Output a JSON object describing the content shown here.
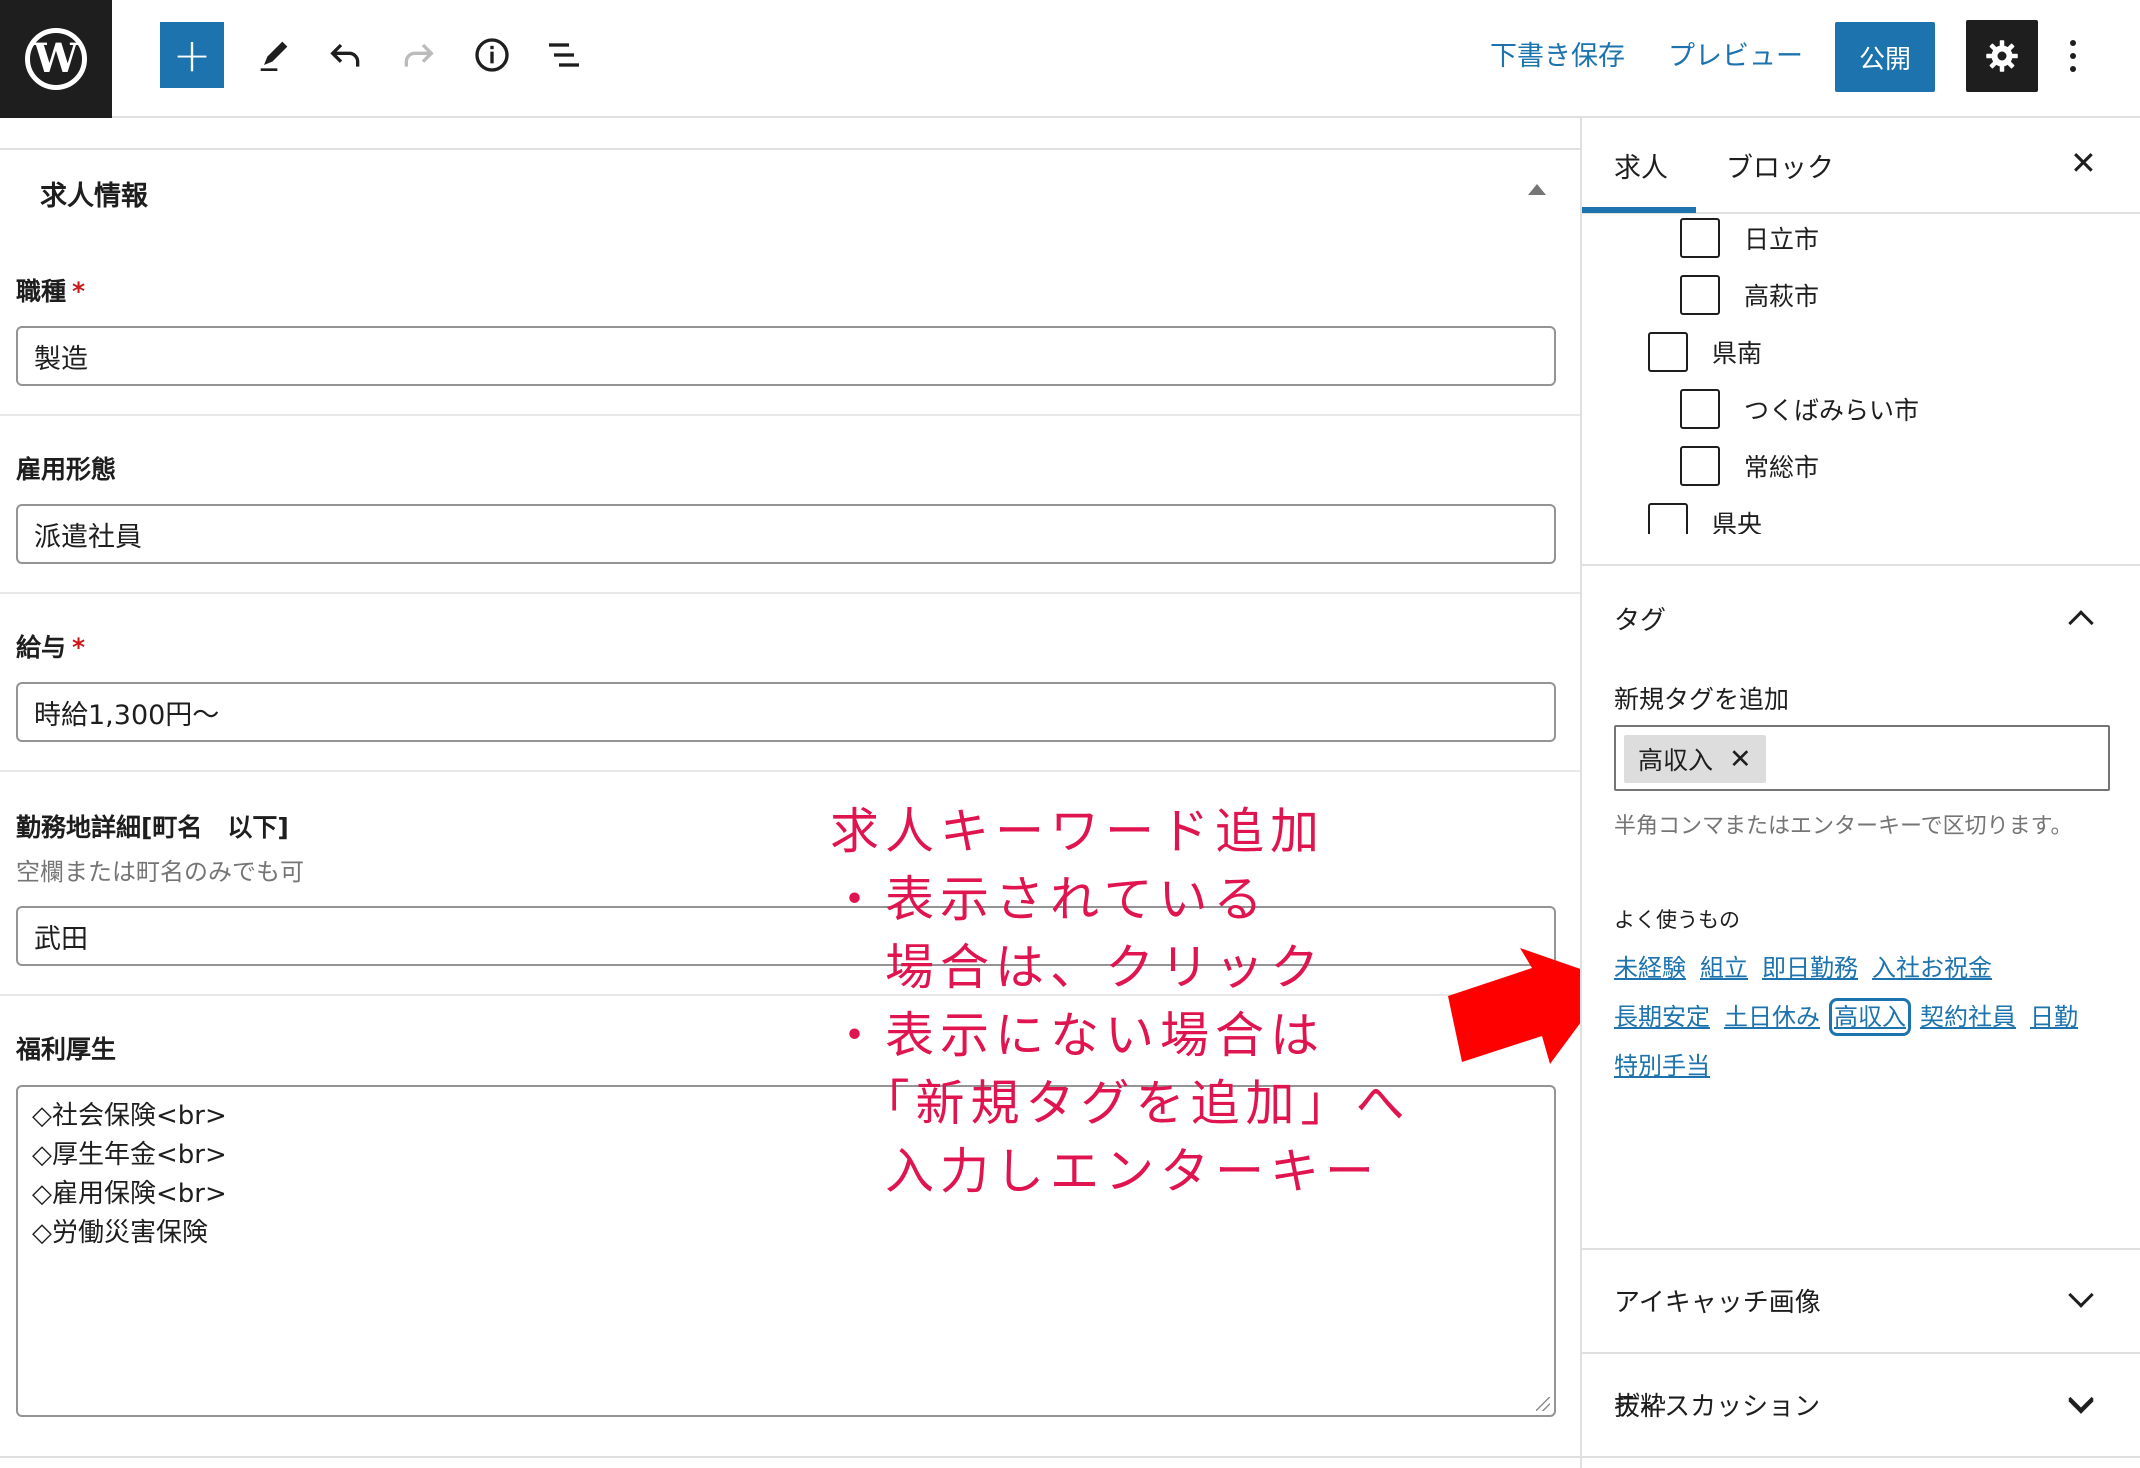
{
  "toolbar": {
    "logo_glyph": "W",
    "add_label": "+",
    "save_draft": "下書き保存",
    "preview": "プレビュー",
    "publish": "公開"
  },
  "panel": {
    "title": "求人情報",
    "fields": {
      "job_type": {
        "label": "職種",
        "required_mark": "*",
        "value": "製造"
      },
      "employment": {
        "label": "雇用形態",
        "value": "派遣社員"
      },
      "salary": {
        "label": "給与",
        "required_mark": "*",
        "value": "時給1,300円〜"
      },
      "location": {
        "label": "勤務地詳細[町名　以下]",
        "desc": "空欄または町名のみでも可",
        "value": "武田"
      },
      "benefits": {
        "label": "福利厚生",
        "lines": [
          "◇社会保険<br>",
          "◇厚生年金<br>",
          "◇雇用保険<br>",
          "◇労働災害保険"
        ]
      }
    }
  },
  "annotation": {
    "color": "#e0144e",
    "lines": [
      "求人キーワード追加",
      "・表示されている",
      "　場合は、クリック",
      "・表示にない場合は",
      "　「新規タグを追加」へ",
      "　入力しエンターキー"
    ]
  },
  "sidebar": {
    "tabs": [
      "求人",
      "ブロック"
    ],
    "close": "✕",
    "categories": [
      {
        "label": "日立市"
      },
      {
        "label": "高萩市"
      },
      {
        "label": "県南"
      },
      {
        "label": "つくばみらい市"
      },
      {
        "label": "常総市"
      },
      {
        "label": "県央"
      }
    ],
    "tags_section": {
      "title": "タグ",
      "add_label": "新規タグを追加",
      "current_tag": "高収入",
      "remove_glyph": "✕",
      "help": "半角コンマまたはエンターキーで区切ります。",
      "common_label": "よく使うもの",
      "common_tags": [
        "未経験",
        "組立",
        "即日勤務",
        "入社お祝金",
        "長期安定",
        "土日休み",
        "高収入",
        "契約社員",
        "日勤",
        "特別手当"
      ]
    },
    "sections": [
      "アイキャッチ画像",
      "抜粋",
      "ディスカッション"
    ]
  },
  "colors": {
    "accent": "#1c73ae",
    "dark": "#1e1e1e",
    "required": "#cc1818",
    "arrow": "#ff0000"
  }
}
